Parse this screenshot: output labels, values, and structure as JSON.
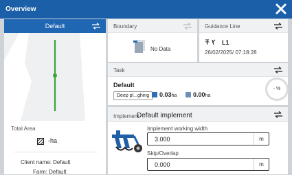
{
  "window": {
    "title": "Overview"
  },
  "left": {
    "field_selector": "Default",
    "total_area_label": "Total Area",
    "total_area_value": "-ha",
    "client_label": "Client name:",
    "client_value": "Default",
    "farm_label": "Farm:",
    "farm_value": "Default"
  },
  "boundary": {
    "title": "Boundary",
    "status": "No Data"
  },
  "guidance": {
    "title": "Guidance Line",
    "name": "L1",
    "date": "26/02/2025/ 07:18:28"
  },
  "task": {
    "title": "Task",
    "name": "Default",
    "tag": "Deep pl...ghing",
    "area_value": "0.03",
    "area_unit": "ha",
    "area2_value": "0.00",
    "area2_unit": "ha",
    "progress": "- %"
  },
  "implement": {
    "label": "Implement",
    "name": "Default implement",
    "width_label": "Implement working width",
    "width_value": "3.000",
    "width_unit": "m",
    "overlap_label": "Skip/Overlap",
    "overlap_value": "0.000",
    "overlap_unit": "m"
  },
  "colors": {
    "titlebar": "#1a5fa8",
    "selector": "#1f66b3",
    "guidance_line": "#3aa63a",
    "task_icon1": "#2a6fb8",
    "task_icon2": "#6a8fb8"
  }
}
